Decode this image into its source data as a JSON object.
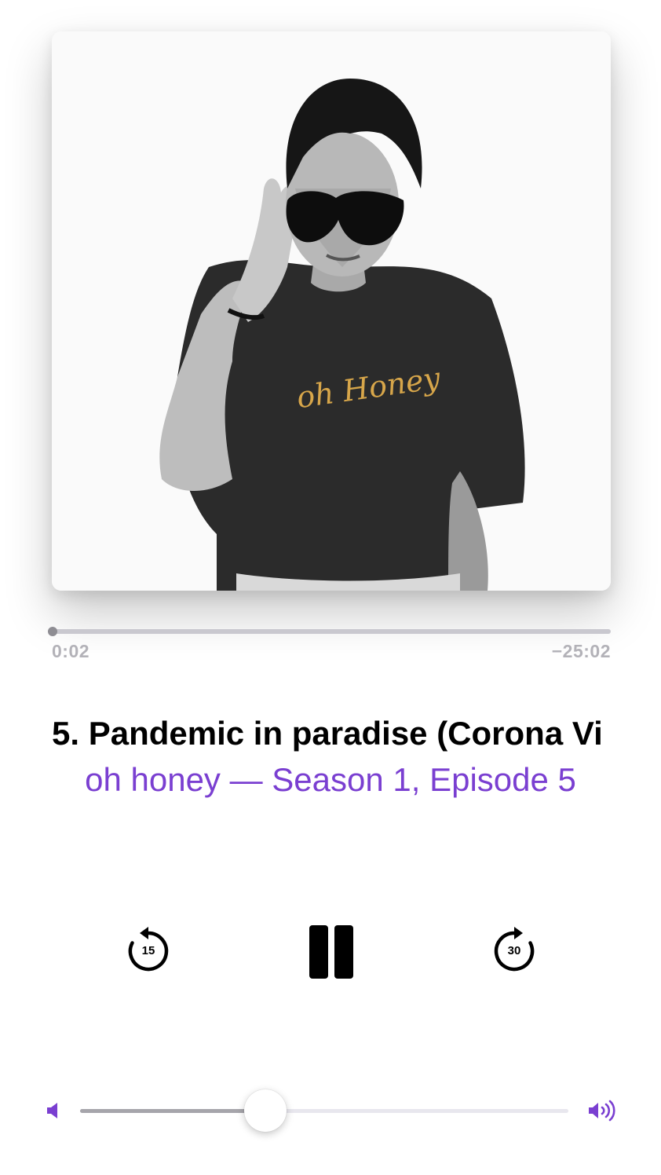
{
  "player": {
    "elapsed": "0:02",
    "remaining": "−25:02",
    "progress_fraction": 0.0013,
    "episode_title": "5. Pandemic in paradise (Corona Vi",
    "show_line": "oh honey — Season 1, Episode 5",
    "artwork_shirt_text": "oh Honey",
    "skip_back_seconds": "15",
    "skip_forward_seconds": "30",
    "volume_fraction": 0.38
  },
  "icons": {
    "skip_back": "gobackward-15-icon",
    "pause": "pause-icon",
    "skip_forward": "goforward-30-icon",
    "volume_low": "speaker-fill-icon",
    "volume_high": "speaker-wave-3-icon"
  },
  "colors": {
    "accent": "#7a3fd1",
    "scrubber_track": "#c9c8cf",
    "time_text": "#b3b2b8"
  }
}
